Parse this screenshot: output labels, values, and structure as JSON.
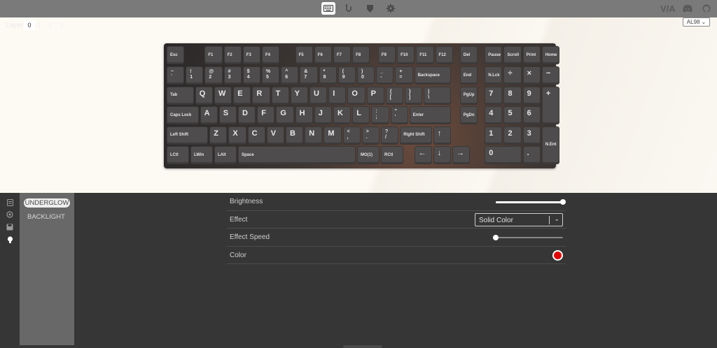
{
  "colors": {
    "accent": "#e00000",
    "topbar": "#7a7a7a",
    "panel": "#363636"
  },
  "nav": {
    "icons": [
      "keyboard-icon",
      "configure-icon",
      "debug-icon",
      "settings-icon"
    ],
    "brand": "V/A",
    "right_icons": [
      "discord-icon",
      "github-icon"
    ]
  },
  "keyboard": {
    "layer_label": "Layer",
    "layer_value": "0",
    "more_layers": "1 2 3",
    "selected_model": "AL98",
    "keys": [
      [
        "Esc"
      ],
      [
        "F1"
      ],
      [
        "F2"
      ],
      [
        "F3"
      ],
      [
        "F4"
      ],
      [
        "F5"
      ],
      [
        "F6"
      ],
      [
        "F7"
      ],
      [
        "F8"
      ],
      [
        "F9"
      ],
      [
        "F10"
      ],
      [
        "F11"
      ],
      [
        "F12"
      ],
      [
        "Del"
      ],
      [
        "Pause"
      ],
      [
        "Scroll"
      ],
      [
        "Print"
      ],
      [
        "Home"
      ],
      [
        "~\n`"
      ],
      [
        "!\n1"
      ],
      [
        "@\n2"
      ],
      [
        "#\n3"
      ],
      [
        "$\n4"
      ],
      [
        "%\n5"
      ],
      [
        "^\n6"
      ],
      [
        "&\n7"
      ],
      [
        "*\n8"
      ],
      [
        "(\n9"
      ],
      [
        ")\n0"
      ],
      [
        "_\n-"
      ],
      [
        "+\n="
      ],
      [
        "Backspace"
      ],
      [
        "End"
      ],
      [
        "N.Lck"
      ],
      [
        "÷"
      ],
      [
        "×"
      ],
      [
        "−"
      ],
      [
        "Tab"
      ],
      [
        "Q"
      ],
      [
        "W"
      ],
      [
        "E"
      ],
      [
        "R"
      ],
      [
        "T"
      ],
      [
        "Y"
      ],
      [
        "U"
      ],
      [
        "I"
      ],
      [
        "O"
      ],
      [
        "P"
      ],
      [
        "{\n["
      ],
      [
        "}\n]"
      ],
      [
        "|\n\\"
      ],
      [
        "PgUp"
      ],
      [
        "7"
      ],
      [
        "8"
      ],
      [
        "9"
      ],
      [
        "+"
      ],
      [
        "Caps Lock"
      ],
      [
        "A"
      ],
      [
        "S"
      ],
      [
        "D"
      ],
      [
        "F"
      ],
      [
        "G"
      ],
      [
        "H"
      ],
      [
        "J"
      ],
      [
        "K"
      ],
      [
        "L"
      ],
      [
        ":\n;"
      ],
      [
        "\"\n'"
      ],
      [
        "Enter"
      ],
      [
        "PgDn"
      ],
      [
        "4"
      ],
      [
        "5"
      ],
      [
        "6"
      ],
      [
        "Left Shift"
      ],
      [
        "Z"
      ],
      [
        "X"
      ],
      [
        "C"
      ],
      [
        "V"
      ],
      [
        "B"
      ],
      [
        "N"
      ],
      [
        "M"
      ],
      [
        "<\n,"
      ],
      [
        ">\n."
      ],
      [
        "?\n/"
      ],
      [
        "Right Shift"
      ],
      [
        "↑"
      ],
      [
        "1"
      ],
      [
        "2"
      ],
      [
        "3"
      ],
      [
        "N.Ent"
      ],
      [
        "LCtl"
      ],
      [
        "LWin"
      ],
      [
        "LAlt"
      ],
      [
        "Space"
      ],
      [
        "MO(1)"
      ],
      [
        "RCtl"
      ],
      [
        "←"
      ],
      [
        "↓"
      ],
      [
        "→"
      ],
      [
        "0"
      ],
      [
        "."
      ]
    ]
  },
  "sidebar": {
    "icons": [
      "keymap-icon",
      "macro-icon",
      "save-icon",
      "lighting-icon"
    ],
    "active": "lighting-icon"
  },
  "submenu": {
    "tabs": [
      "UNDERGLOW",
      "BACKLIGHT"
    ],
    "active": "UNDERGLOW"
  },
  "settings": {
    "brightness": {
      "label": "Brightness",
      "value_pct": 100
    },
    "effect": {
      "label": "Effect",
      "value": "Solid Color"
    },
    "effect_speed": {
      "label": "Effect Speed",
      "value_pct": 0
    },
    "color": {
      "label": "Color",
      "value": "#e00000"
    }
  }
}
